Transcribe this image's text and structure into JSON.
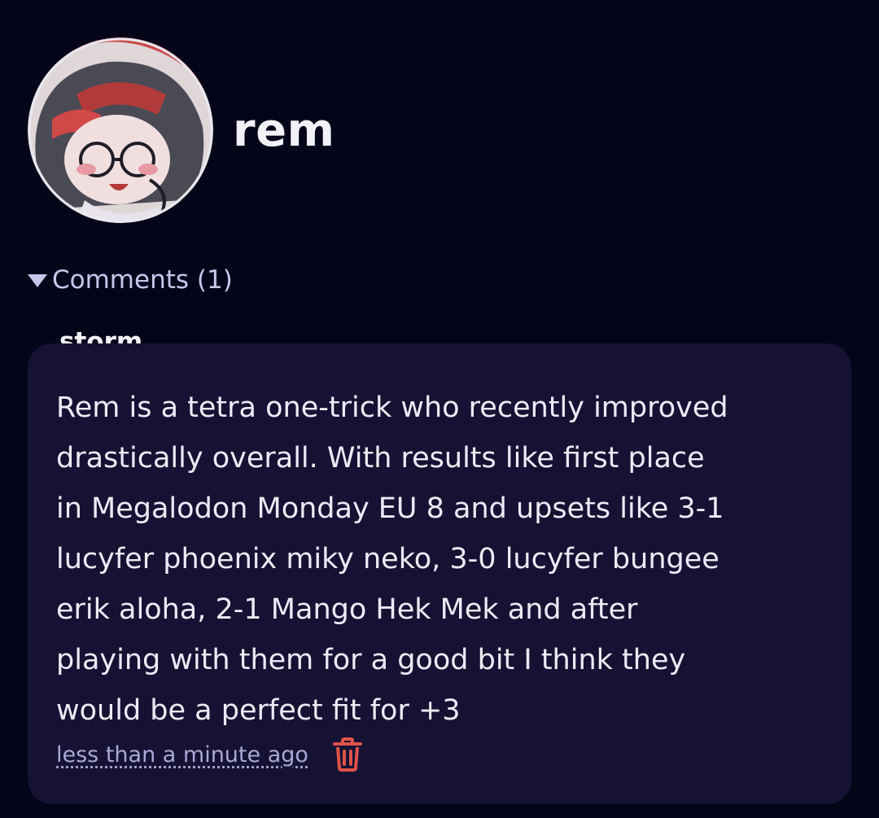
{
  "profile": {
    "username": "rem",
    "avatar_icon": "avatar-image"
  },
  "comments": {
    "toggle_label": "Comments (1)",
    "items": [
      {
        "author": "storm",
        "lines": [
          "Rem is a tetra one-trick who recently improved",
          "drastically overall. With results like first place",
          "in Megalodon Monday EU 8 and upsets like 3-1",
          "lucyfer phoenix miky neko, 3-0 lucyfer bungee",
          "erik aloha, 2-1 Mango Hek Mek and after",
          "playing with them for a good bit I think they",
          "would be a perfect fit for +3"
        ],
        "timestamp": "less than a minute ago",
        "delete_icon": "trash-icon"
      }
    ]
  },
  "colors": {
    "background": "#05051a",
    "card": "#151233",
    "accent_muted": "#c9c6ec",
    "delete": "#e0534a"
  }
}
